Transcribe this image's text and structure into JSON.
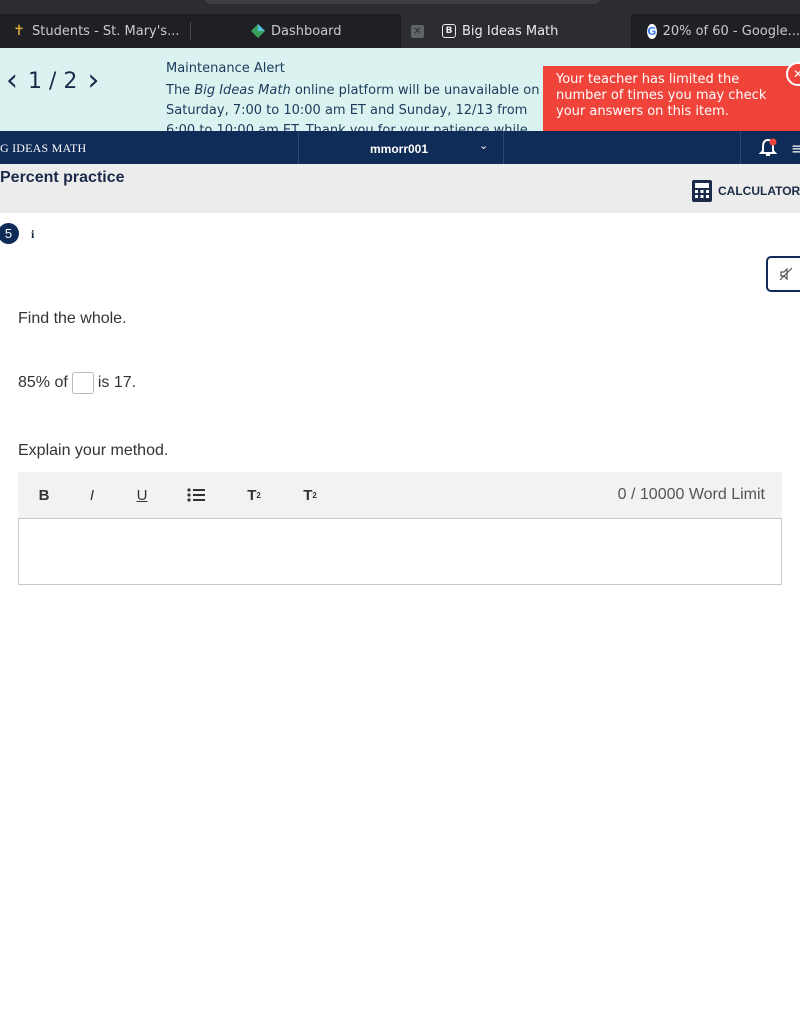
{
  "browser": {
    "tabs": [
      {
        "label": "Students - St. Mary's...",
        "icon": "cross-icon",
        "active": false
      },
      {
        "label": "Dashboard",
        "icon": "dashboard-icon",
        "active": false
      },
      {
        "label": "Big Ideas Math",
        "icon": "b-icon",
        "active": true
      },
      {
        "label": "20% of 60 - Google...",
        "icon": "google-icon",
        "active": false
      }
    ],
    "close_glyph": "✕",
    "b_glyph": "B",
    "google_glyph": "G"
  },
  "alert": {
    "pager_prev": "‹",
    "pager_count": "1 / 2",
    "pager_next": "›",
    "title": "Maintenance Alert",
    "text_prefix": "The ",
    "text_brand": "Big Ideas Math",
    "text_rest": " online platform will be unavailable on Saturday, 7:00 to 10:00 am ET and Sunday, 12/13 from 6:00 to 10:00 am ET. Thank you for your patience while we update our system."
  },
  "toast": {
    "message": "Your teacher has limited the number of times you may check your answers on this item.",
    "close": "✕"
  },
  "nav": {
    "brand": "G IDEAS MATH",
    "username": "mmorr001",
    "caret": "⌄",
    "menu": "≡"
  },
  "assignment": {
    "title": "Percent practice",
    "calculators_label": "CALCULATORS"
  },
  "question": {
    "number": "5",
    "info": "i",
    "prompt": "Find the whole.",
    "eq_before": "85% of",
    "eq_after": "is 17.",
    "explain": "Explain your method."
  },
  "editor": {
    "bold": "B",
    "italic": "I",
    "underline": "U",
    "superscript_base": "T",
    "superscript_mark": "2",
    "subscript_base": "T",
    "subscript_mark": "2",
    "word_limit": "0 / 10000 Word Limit"
  },
  "colors": {
    "nav_bg": "#0f2b57",
    "alert_bg": "#dbf3f0",
    "toast_bg": "#f0443a"
  }
}
